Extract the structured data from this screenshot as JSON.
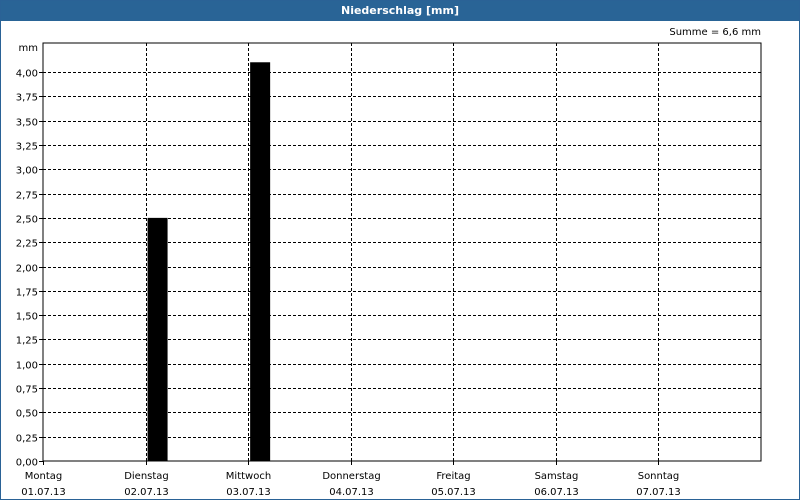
{
  "window": {
    "title": "Niederschlag [mm]"
  },
  "summary": "Summe = 6,6 mm",
  "chart_data": {
    "type": "bar",
    "title": "Niederschlag [mm]",
    "ylabel": "mm",
    "xlabel": "",
    "ylim": [
      0,
      4.0
    ],
    "y_ticks": [
      "0,00",
      "0,25",
      "0,50",
      "0,75",
      "1,00",
      "1,25",
      "1,50",
      "1,75",
      "2,00",
      "2,25",
      "2,50",
      "2,75",
      "3,00",
      "3,25",
      "3,50",
      "3,75",
      "4,00"
    ],
    "categories": [
      {
        "day": "Montag",
        "date": "01.07.13"
      },
      {
        "day": "Dienstag",
        "date": "02.07.13"
      },
      {
        "day": "Mittwoch",
        "date": "03.07.13"
      },
      {
        "day": "Donnerstag",
        "date": "04.07.13"
      },
      {
        "day": "Freitag",
        "date": "05.07.13"
      },
      {
        "day": "Samstag",
        "date": "06.07.13"
      },
      {
        "day": "Sonntag",
        "date": "07.07.13"
      }
    ],
    "values": [
      0,
      2.5,
      4.1,
      0,
      0,
      0,
      0
    ],
    "grid": true,
    "bar_color": "#000000"
  },
  "colors": {
    "titlebar": "#296496",
    "grid": "#000000"
  }
}
